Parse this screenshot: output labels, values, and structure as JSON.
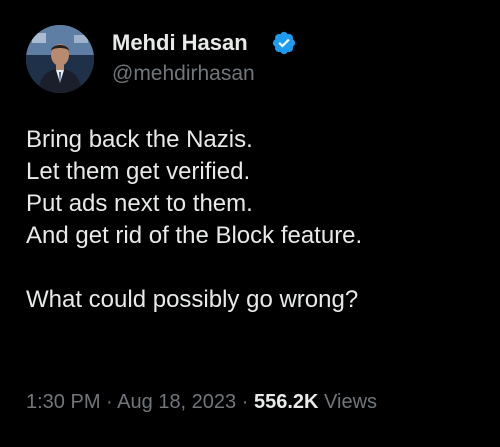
{
  "author": {
    "display_name": "Mehdi Hasan",
    "handle": "@mehdirhasan"
  },
  "tweet": {
    "lines": [
      "Bring back the Nazis.",
      "Let them get verified.",
      "Put ads next to them.",
      "And get rid of the Block feature."
    ],
    "closing": "What could possibly go wrong?"
  },
  "meta": {
    "time": "1:30 PM",
    "separator": "·",
    "date": "Aug 18, 2023",
    "views_count": "556.2K",
    "views_label": "Views"
  },
  "colors": {
    "background": "#000000",
    "text_primary": "#e7e9ea",
    "text_secondary": "#71767b",
    "verified": "#1d9bf0"
  },
  "icons": {
    "verified": "verified-badge-icon",
    "avatar": "profile-photo"
  }
}
